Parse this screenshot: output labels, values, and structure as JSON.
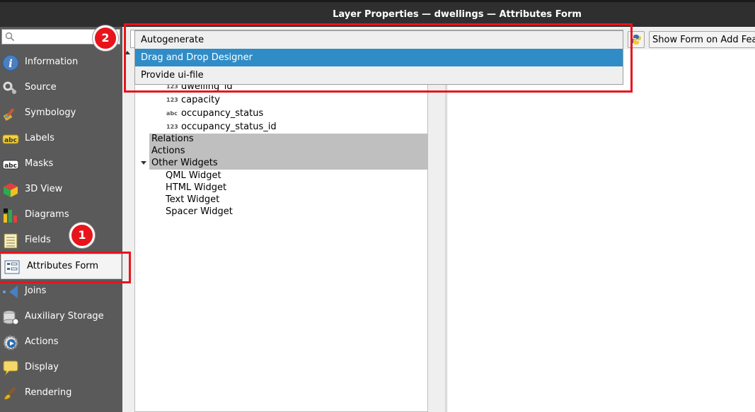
{
  "window": {
    "title": "Layer Properties — dwellings — Attributes Form"
  },
  "sidebar": {
    "search_placeholder": "",
    "items": [
      {
        "label": "Information",
        "icon": "info-icon"
      },
      {
        "label": "Source",
        "icon": "source-icon"
      },
      {
        "label": "Symbology",
        "icon": "symbology-icon"
      },
      {
        "label": "Labels",
        "icon": "labels-icon"
      },
      {
        "label": "Masks",
        "icon": "masks-icon"
      },
      {
        "label": "3D View",
        "icon": "3d-view-icon"
      },
      {
        "label": "Diagrams",
        "icon": "diagrams-icon"
      },
      {
        "label": "Fields",
        "icon": "fields-icon"
      },
      {
        "label": "Attributes Form",
        "icon": "attributes-form-icon"
      },
      {
        "label": "Joins",
        "icon": "joins-icon"
      },
      {
        "label": "Auxiliary Storage",
        "icon": "auxiliary-storage-icon"
      },
      {
        "label": "Actions",
        "icon": "actions-icon"
      },
      {
        "label": "Display",
        "icon": "display-icon"
      },
      {
        "label": "Rendering",
        "icon": "rendering-icon"
      }
    ],
    "active_index": 8
  },
  "form_layout_dropdown": {
    "options": [
      "Autogenerate",
      "Drag and Drop Designer",
      "Provide ui-file"
    ],
    "selected": "Drag and Drop Designer"
  },
  "toolbar": {
    "show_form_label": "Show Form on Add Fea",
    "python_icon": "python-icon"
  },
  "tree": {
    "fields": [
      {
        "type": "123",
        "name": "dwelling_id"
      },
      {
        "type": "123",
        "name": "capacity"
      },
      {
        "type": "abc",
        "name": "occupancy_status"
      },
      {
        "type": "123",
        "name": "occupancy_status_id"
      }
    ],
    "groups": [
      "Relations",
      "Actions",
      "Other Widgets"
    ],
    "widgets": [
      "QML Widget",
      "HTML Widget",
      "Text Widget",
      "Spacer Widget"
    ]
  },
  "annotations": {
    "badge1": "1",
    "badge2": "2",
    "highlight_color": "#e8141c"
  },
  "colors": {
    "selection": "#308cc6",
    "sidebar_bg": "#5a5a5a"
  }
}
